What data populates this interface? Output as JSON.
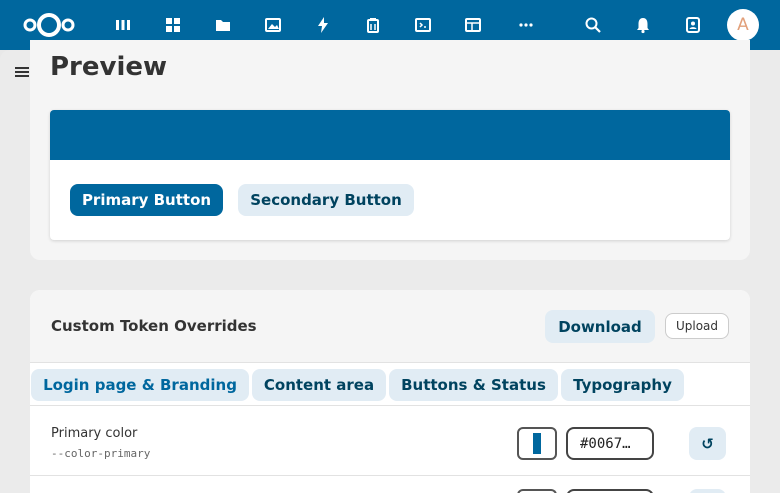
{
  "header": {
    "avatar_letter": "A",
    "nav_icons": [
      "dashboard-icon",
      "apps-grid-icon",
      "files-icon",
      "photos-icon",
      "activity-icon",
      "deck-icon",
      "code-icon",
      "tables-icon",
      "more-icon",
      "search-icon",
      "notifications-icon",
      "contacts-icon"
    ]
  },
  "preview": {
    "title": "Preview",
    "primary_button": "Primary Button",
    "secondary_button": "Secondary Button"
  },
  "overrides": {
    "title": "Custom Token Overrides",
    "download_label": "Download",
    "upload_label": "Upload",
    "tabs": [
      {
        "label": "Login page & Branding",
        "active": true
      },
      {
        "label": "Content area",
        "active": false
      },
      {
        "label": "Buttons & Status",
        "active": false
      },
      {
        "label": "Typography",
        "active": false
      }
    ],
    "rows": [
      {
        "label": "Primary color",
        "variable": "--color-primary",
        "value": "#0067…",
        "reset_icon": "↺"
      }
    ]
  },
  "colors": {
    "primary": "#00679e",
    "secondary_bg": "#e1ecf4",
    "secondary_text": "#00435f"
  }
}
